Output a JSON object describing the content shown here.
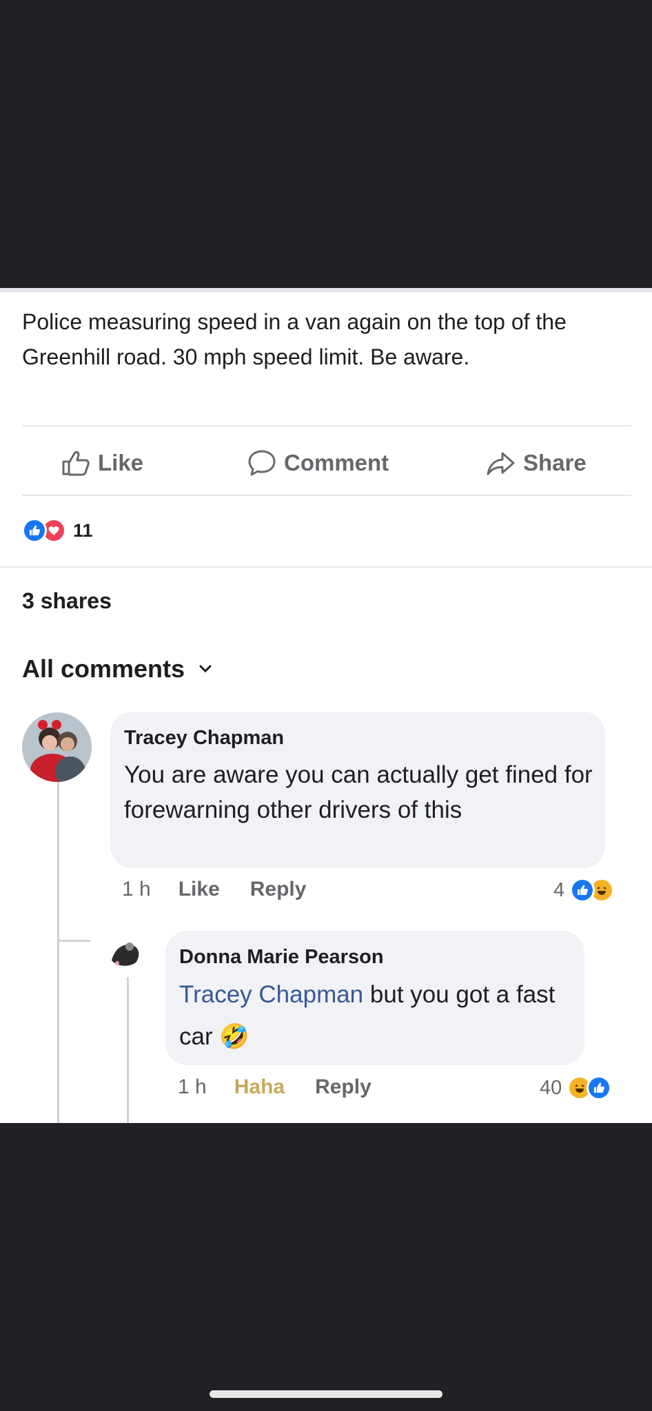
{
  "post": {
    "text": "Police measuring speed in a van again on the top of the Greenhill road. 30 mph speed limit. Be aware."
  },
  "actions": {
    "like_label": "Like",
    "comment_label": "Comment",
    "share_label": "Share"
  },
  "reactions": {
    "icons": [
      "like",
      "love"
    ],
    "count": "11"
  },
  "shares_text": "3 shares",
  "comments_filter": {
    "label": "All comments",
    "icon": "chevron-down-icon"
  },
  "comments": [
    {
      "author": "Tracey Chapman",
      "text": "You are aware you can actually get fined for forewarning other drivers of this",
      "time": "1 h",
      "like_label": "Like",
      "reply_label": "Reply",
      "reaction_count": "4",
      "reaction_icons": [
        "like",
        "haha"
      ],
      "reply": {
        "author": "Donna Marie Pearson",
        "mention": "Tracey Chapman",
        "text": "but you got a fast car",
        "emoji": "🤣",
        "time": "1 h",
        "reaction_label": "Haha",
        "reply_label": "Reply",
        "reaction_count": "40",
        "reaction_icons": [
          "haha",
          "like"
        ]
      }
    }
  ],
  "colors": {
    "background": "#202124",
    "text": "#1c1e21",
    "secondary": "#65676b",
    "bubble": "#f0f2f5",
    "like_blue": "#1877f2",
    "love_red": "#f33e58",
    "haha_yellow": "#f7b125",
    "mention": "#385898"
  }
}
